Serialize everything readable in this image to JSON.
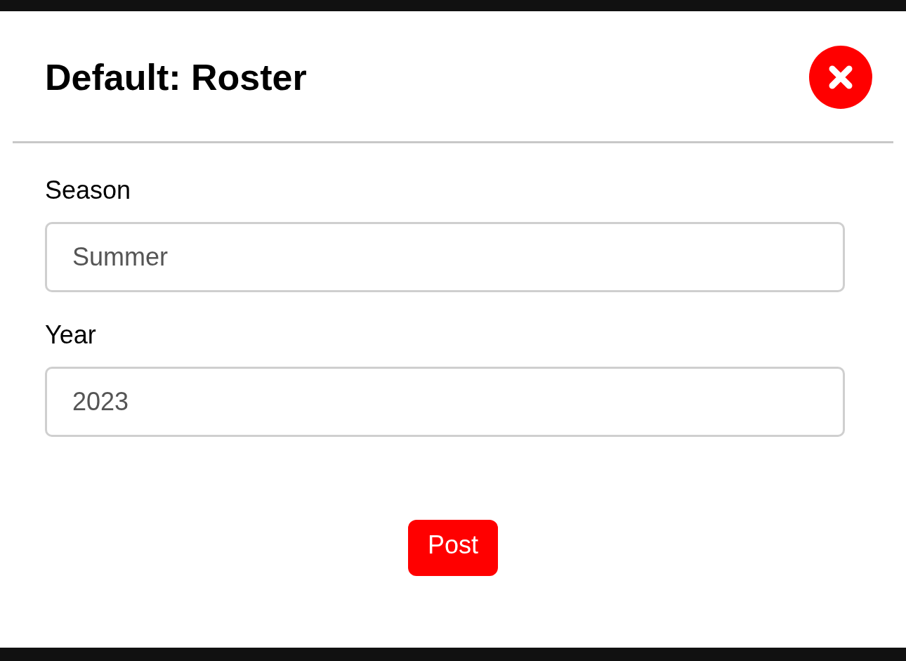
{
  "dialog": {
    "title": "Default: Roster"
  },
  "fields": [
    {
      "label": "Season",
      "value": "Summer"
    },
    {
      "label": "Year",
      "value": "2023"
    }
  ],
  "submit": {
    "label": "Post"
  }
}
